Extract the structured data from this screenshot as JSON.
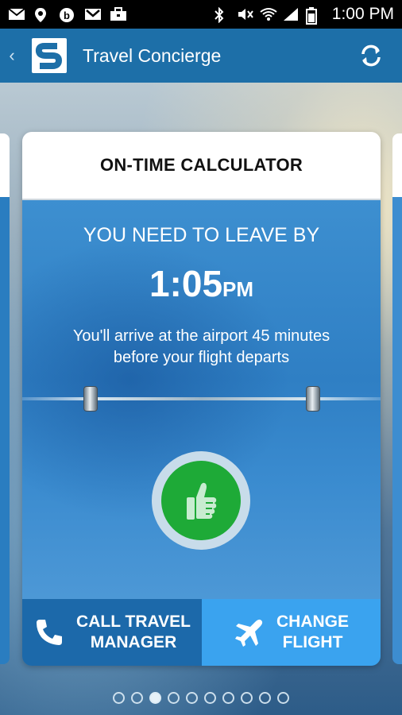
{
  "status_bar": {
    "time": "1:00 PM",
    "icons": [
      "mail-icon",
      "location-icon",
      "b-icon",
      "gmail-icon",
      "briefcase-icon",
      "bluetooth-icon",
      "mute-icon",
      "wifi-icon",
      "signal-icon",
      "battery-icon"
    ]
  },
  "app_bar": {
    "title": "Travel Concierge",
    "logo_letter": "S"
  },
  "card": {
    "title": "ON-TIME CALCULATOR",
    "leave_label": "YOU NEED TO LEAVE BY",
    "leave_time": "1:05",
    "leave_ampm": "PM",
    "arrive_line1": "You'll arrive at the airport 45 minutes",
    "arrive_line2": "before your flight departs"
  },
  "footer": {
    "call_line1": "CALL TRAVEL",
    "call_line2": "MANAGER",
    "change_line1": "CHANGE",
    "change_line2": "FLIGHT"
  },
  "pager": {
    "count": 10,
    "active_index": 2
  },
  "colors": {
    "app_bar": "#1d6fa8",
    "call_button": "#1c69aa",
    "change_button": "#3aa3ef",
    "thumb_green": "#1eaa37"
  }
}
